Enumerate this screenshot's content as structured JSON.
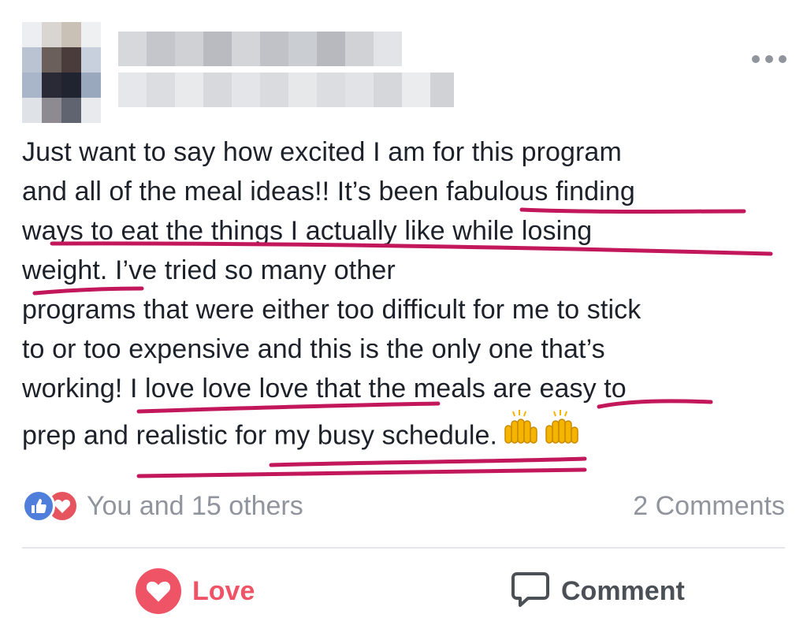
{
  "post": {
    "lines": [
      "Just want to say how excited I am for this program",
      "and all of the meal ideas!! It’s been fabulous finding",
      "ways to eat the things I actually like while losing",
      "weight. I’ve tried so many other",
      "programs that were either too difficult for me to stick",
      "to or too expensive and this is the only one that’s",
      "working! I love love love that the meals are easy to",
      "prep and realistic for my busy schedule."
    ],
    "emoji": "raising-hands-emoji"
  },
  "reactions": {
    "summary": "You and 15 others",
    "comments": "2 Comments",
    "icons": [
      "like-icon",
      "love-icon"
    ]
  },
  "actions": {
    "love_label": "Love",
    "comment_label": "Comment"
  },
  "colors": {
    "highlight": "#c2185b",
    "love": "#ee5466",
    "like": "#4f7fdb",
    "muted": "#90949c"
  }
}
